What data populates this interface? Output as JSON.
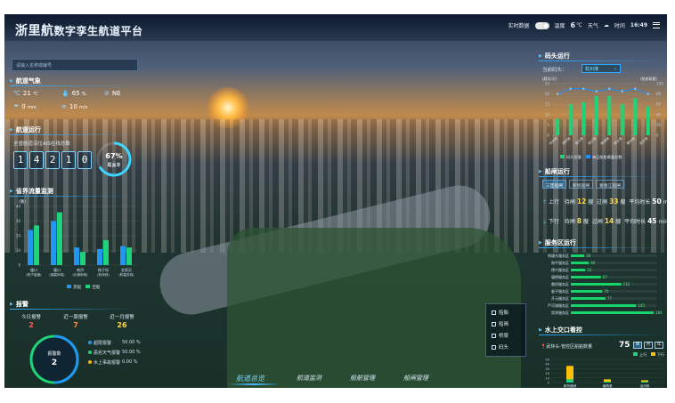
{
  "header": {
    "title_big": "浙里航",
    "title_rest": "数字孪生航道平台",
    "realtime_label": "实时数据",
    "temp_label": "温度",
    "temp_value": "6",
    "temp_unit": "℃",
    "weather_label": "天气",
    "time_label": "时间",
    "time_value": "16:49"
  },
  "search": {
    "placeholder": "请输入名称或编号"
  },
  "weather": {
    "title": "航道气象",
    "temperature": "21",
    "temperature_unit": "℃",
    "humidity": "65",
    "humidity_unit": "%",
    "wind_dir": "NE",
    "rain": "0",
    "rain_unit": "mm",
    "wind_speed": "10",
    "wind_speed_unit": "m/s"
  },
  "operations": {
    "title": "航道运行",
    "subtitle": "全省航道沿位AIS在线总数",
    "digits": [
      "1",
      "4",
      "2",
      "1",
      "0"
    ],
    "coverage_value": "67%",
    "coverage_fraction": 0.67,
    "coverage_label": "覆盖率"
  },
  "boundary": {
    "title": "省界流量监测",
    "unit": "(艘)",
    "chart_data": {
      "type": "bar",
      "categories": [
        {
          "line1": "塘口",
          "line2": "(杭宁高速)"
        },
        {
          "line1": "塘口",
          "line2": "(湖嘉申线)"
        },
        {
          "line1": "南浔",
          "line2": "(长湖申线)"
        },
        {
          "line1": "杨子坝",
          "line2": "(杭申线)"
        },
        {
          "line1": "金家浜",
          "line2": "(杭嘉苏线)"
        }
      ],
      "series": [
        {
          "name": "货船",
          "color": "#2196f3",
          "values": [
            24,
            30,
            12,
            11,
            13
          ]
        },
        {
          "name": "空船",
          "color": "#1ed47a",
          "values": [
            27,
            36,
            9,
            17,
            12
          ]
        }
      ],
      "ylim": [
        0,
        40
      ],
      "legend_position": "bottom"
    }
  },
  "alarms": {
    "title": "报警",
    "items": [
      {
        "label": "今日报警",
        "count": "2",
        "color": "#ff5b5b"
      },
      {
        "label": "近一周报警",
        "count": "7",
        "color": "#ff8a3d"
      },
      {
        "label": "近一月报警",
        "count": "26",
        "color": "#ffd84a"
      }
    ],
    "ring_label": "报警数",
    "ring_count": "2",
    "breakdown": [
      {
        "label": "超限报警",
        "value": "50.00 %",
        "color": "#2196f3"
      },
      {
        "label": "恶劣天气报警",
        "value": "50.00 %",
        "color": "#1ed47a"
      },
      {
        "label": "水上事故报警",
        "value": "0.00 %",
        "color": "#ffb300"
      }
    ]
  },
  "layers": {
    "items": [
      "船舶",
      "船闸",
      "桥梁",
      "码头"
    ]
  },
  "nav": {
    "tabs": [
      "航道总览",
      "航道监测",
      "船舶管理",
      "船闸管理"
    ],
    "active": 0
  },
  "dock": {
    "title": "码头运行",
    "select_label": "当前码头：",
    "select_value": "杭州港",
    "left_unit": "(艘次/天)",
    "right_unit": "(船舶载重)",
    "left_ticks": [
      "25",
      "20",
      "15",
      "10",
      "5",
      "0"
    ],
    "right_ticks": [
      "100",
      "80",
      "60",
      "40",
      "20",
      "0"
    ],
    "legend": [
      "码头货量",
      "每日船舶载重总数"
    ],
    "chart_data": {
      "type": "bar",
      "categories": [
        "杭州港",
        "湖州港",
        "嘉兴港",
        "绍兴港",
        "乾潮港",
        "丽水港",
        "衢州港",
        "金华港"
      ],
      "series": [
        {
          "name": "码头货量",
          "color": "#1ed47a",
          "values": [
            8,
            15,
            16,
            19,
            19,
            15,
            18,
            14
          ]
        },
        {
          "name": "每日船舶载重总数",
          "color": "#1e90ff",
          "values": [
            80,
            90,
            90,
            85,
            90,
            85,
            90,
            80
          ]
        }
      ],
      "ylim_left": [
        0,
        25
      ],
      "ylim_right": [
        0,
        100
      ]
    }
  },
  "lock": {
    "title": "船闸运行",
    "tabs": [
      "三堡船闸",
      "新坝船闸",
      "富春江船闸"
    ],
    "active_tab": 0,
    "up": {
      "label": "上行",
      "wait_label": "待闸",
      "wait": "12",
      "unit": "艘",
      "pass_label": "过闸",
      "pass": "33",
      "avg_label": "平均时长",
      "avg": "50",
      "avg_unit": "min"
    },
    "down": {
      "label": "下行",
      "wait_label": "待闸",
      "wait": "8",
      "unit": "艘",
      "pass_label": "过闸",
      "pass": "14",
      "avg_label": "平均时长",
      "avg": "45",
      "avg_unit": "min"
    }
  },
  "service": {
    "title": "服务区运行",
    "chart_data": {
      "type": "bar",
      "categories": [
        "钱塘东服务区",
        "和平服务区",
        "德兴服务区",
        "塘栖服务区",
        "鼎桥服务区",
        "临平服务区",
        "开元服务区",
        "严河湖服务区",
        "崇贤服务区"
      ],
      "values": [
        30,
        40,
        32,
        67,
        112,
        70,
        77,
        145,
        184
      ],
      "xlim": [
        0,
        190
      ]
    }
  },
  "water": {
    "title": "水上交口看控",
    "subtitle": "武林头-管控区船舶数量",
    "total": "75",
    "chips": [
      "周",
      "月",
      "年"
    ],
    "legend": [
      "上行",
      "下行"
    ],
    "ticks": [
      "50",
      "40",
      "30",
      "20",
      "10",
      "0"
    ],
    "chart_data": {
      "type": "bar",
      "stacked": true,
      "categories": [
        "新桥通闸",
        "塘栖港",
        "运河桥"
      ],
      "series": [
        {
          "name": "上行",
          "color": "#1ed47a",
          "values": [
            7,
            2,
            2
          ]
        },
        {
          "name": "下行",
          "color": "#ffc107",
          "values": [
            29,
            5,
            3
          ]
        }
      ],
      "ylim": [
        0,
        50
      ]
    }
  }
}
